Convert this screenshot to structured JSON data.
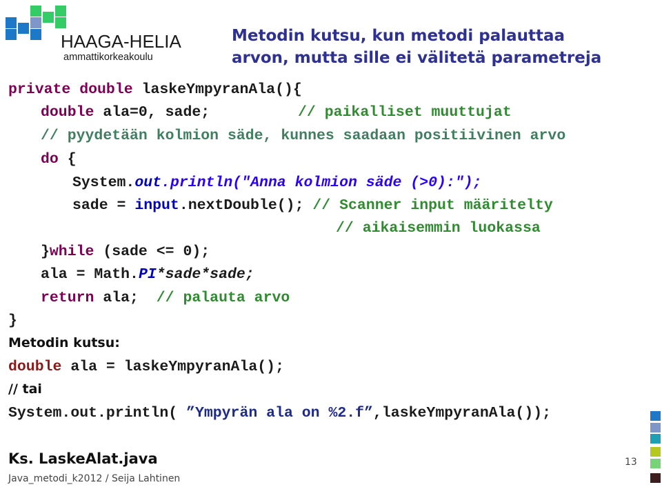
{
  "logo": {
    "name": "HAAGA-HELIA",
    "subtitle": "ammattikorkeakoulu",
    "colors": {
      "blue": "#1e78c8",
      "periwinkle": "#7f96c8",
      "green": "#33cc66"
    }
  },
  "title": {
    "line1": "Metodin kutsu, kun metodi palauttaa",
    "line2": "arvon, mutta sille ei välitetä parametreja"
  },
  "code": {
    "l1": {
      "kw": "private double ",
      "rest": "laskeYmpyranAla(){"
    },
    "l2": {
      "kw": "double ",
      "rest": "ala=0, sade;",
      "pad": "           ",
      "comment": "// paikalliset muuttujat"
    },
    "l3": {
      "comment": "// pyydetään kolmion säde, kunnes saadaan positiivinen arvo"
    },
    "l4": {
      "kw": "do",
      "rest": " {"
    },
    "l5": {
      "a": "System.",
      "b": "out",
      "c": ".println(\"Anna kolmion säde (>0):\");"
    },
    "l6": {
      "a": "sade = ",
      "b": "input",
      "c": ".nextDouble(); ",
      "comment": "// Scanner input määritelty"
    },
    "l7": {
      "comment": "// aikaisemmin luokassa"
    },
    "l8": {
      "a": "}",
      "kw": "while",
      "rest": " (sade <= 0);"
    },
    "l9": {
      "a": "ala = Math.",
      "b": "PI",
      "c": "*sade*sade;"
    },
    "l10": {
      "kw": "return",
      "rest": " ala;  ",
      "comment": "// palauta arvo"
    },
    "l11": {
      "rest": "}"
    }
  },
  "call": {
    "label": "Metodin kutsu:",
    "l1": {
      "kw": "double",
      "rest": " ala = laskeYmpyranAla();"
    },
    "or_label": "// tai",
    "l2": {
      "a": "System.out.println( ",
      "str": "”Ympyrän ala on %2.f”",
      "rest": ",laskeYmpyranAla());"
    }
  },
  "see_also": "Ks. LaskeAlat.java",
  "footer": "Java_metodi_k2012 / Seija Lahtinen",
  "page_number": "13",
  "side_squares": [
    "#1e78c8",
    "#7f96c8",
    "#1ea0b4",
    "#b4c81e",
    "#78d278",
    "#3c1e1e"
  ]
}
